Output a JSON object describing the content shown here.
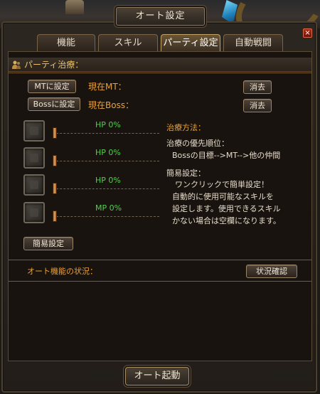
{
  "window": {
    "title": "オート設定"
  },
  "tabs": [
    {
      "label": "機能"
    },
    {
      "label": "スキル"
    },
    {
      "label": "パーティ設定"
    },
    {
      "label": "自動戦闘"
    }
  ],
  "party_heal": {
    "section_title": "パーティ治療：",
    "mt_button": "MTに設定",
    "mt_current": "現在MT：",
    "mt_clear": "消去",
    "boss_button": "Bossに設定",
    "boss_current": "現在Boss：",
    "boss_clear": "消去",
    "slots": [
      {
        "stat": "HP 0%"
      },
      {
        "stat": "HP 0%"
      },
      {
        "stat": "HP 0%"
      },
      {
        "stat": "MP 0%"
      }
    ],
    "simple_setup_button": "簡易設定",
    "method": {
      "heading": "治療方法：",
      "priority_label": "治療の優先順位：",
      "priority_value": "Bossの目標-->MT-->他の仲間",
      "simple_label": "簡易設定：",
      "simple_lines": [
        "ワンクリックで簡単設定！",
        "自動的に使用可能なスキルを",
        "設定します。使用できるスキル",
        "かない場合は空欄になります。"
      ]
    }
  },
  "auto_status": {
    "section_title": "オート機能の状況：",
    "check_button": "状況確認"
  },
  "footer": {
    "start_button": "オート起動"
  },
  "colors": {
    "accent_gold": "#e8c06a",
    "heading_orange": "#e8a23a",
    "stat_green": "#4fd14a",
    "close_red": "#b32a1c"
  },
  "icons": {
    "close": "close-icon",
    "section": "party-icon"
  }
}
